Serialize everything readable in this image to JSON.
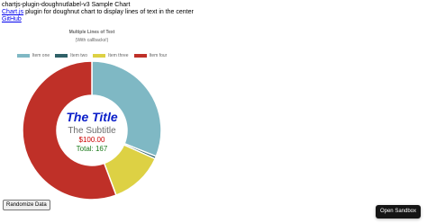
{
  "header": {
    "title": "chartjs-plugin-doughnutlabel-v3 Sample Chart",
    "chartjs_link": "Chart.js",
    "desc_rest": " plugin for doughnut chart to display lines of text in the center",
    "github_link": "GitHub"
  },
  "chart_data": {
    "type": "pie",
    "doughnut": true,
    "title": "Multiple Lines of Text",
    "subtitle": "(With callbacks!)",
    "categories": [
      "Item one",
      "Item two",
      "Item three",
      "Item four"
    ],
    "values": [
      52,
      1,
      21,
      93
    ],
    "colors": [
      "#7fb8c4",
      "#2f6168",
      "#ddd144",
      "#bf3028"
    ],
    "center": {
      "line1": "The Title",
      "line2": "The Subtitle",
      "line3": "$100.00",
      "line4": "Total: 167",
      "colors": [
        "#0b1fc9",
        "#6b6b6b",
        "#cc0000",
        "#1a7a1a"
      ]
    },
    "legend_position": "top"
  },
  "buttons": {
    "randomize": "Randomize Data",
    "sandbox": "Open Sandbox"
  }
}
